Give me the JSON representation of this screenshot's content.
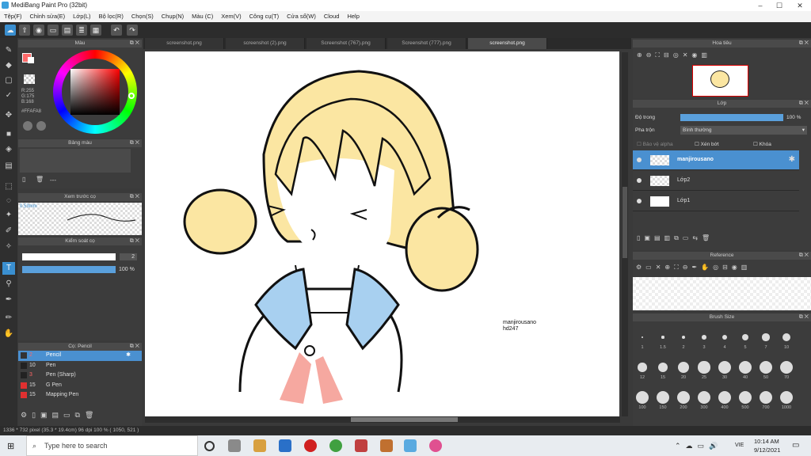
{
  "window": {
    "title": "MediBang Paint Pro (32bit)",
    "minimize": "–",
    "maximize": "☐",
    "close": "✕"
  },
  "menu": [
    "Tệp(F)",
    "Chỉnh sửa(E)",
    "Lớp(L)",
    "Bộ lọc(R)",
    "Chọn(S)",
    "Chụp(N)",
    "Màu (C)",
    "Xem(V)",
    "Công cụ(T)",
    "Cửa sổ(W)",
    "Cloud",
    "Help"
  ],
  "tabs": [
    "screenshot.png",
    "screenshot (2).png",
    "Screenshot (767).png",
    "Screenshot (777).png",
    "screenshot.png"
  ],
  "color_panel": {
    "title": "Màu",
    "r": "R:255",
    "g": "G:175",
    "b": "B:168",
    "hex": "#FFAFA8"
  },
  "palette_panel": {
    "title": "Bảng màu",
    "more": "---"
  },
  "preview_panel": {
    "title": "Xem trước cọ",
    "size": "0.53mm"
  },
  "control_panel": {
    "title": "Kiểm soát cọ",
    "size_value": "2",
    "opacity_value": "100 %"
  },
  "brush_panel": {
    "title": "Cọ: Pencil",
    "items": [
      {
        "size": "2",
        "name": "Pencil",
        "color": "#333333"
      },
      {
        "size": "10",
        "name": "Pen",
        "color": "#222222"
      },
      {
        "size": "3",
        "name": "Pen (Sharp)",
        "color": "#222222"
      },
      {
        "size": "15",
        "name": "G Pen",
        "color": "#e03030"
      },
      {
        "size": "15",
        "name": "Mapping Pen",
        "color": "#e03030"
      }
    ]
  },
  "canvas_text": {
    "line1": "manjirousano",
    "line2": "hd247"
  },
  "status": "1336 * 732 pixel  (35.3 * 19.4cm)  96 dpi  100 %  ( 1050, 521 )",
  "navigator": {
    "title": "Hoa tiêu"
  },
  "layer_panel": {
    "title": "Lớp",
    "opacity_label": "Độ trong",
    "opacity_value": "100 %",
    "blend_label": "Pha trộn",
    "blend_value": "Bình thường",
    "protect_alpha": "Bảo vệ alpha",
    "clipping": "Xén bớt",
    "lock": "Khóa",
    "layers": [
      "manjirousano",
      "Lớp2",
      "Lớp1"
    ]
  },
  "reference_panel": {
    "title": "Reference"
  },
  "size_panel": {
    "title": "Brush Size",
    "sizes": [
      "1",
      "1.5",
      "2",
      "3",
      "4",
      "5",
      "7",
      "10",
      "12",
      "15",
      "20",
      "25",
      "30",
      "40",
      "50",
      "70",
      "100",
      "150",
      "200",
      "300",
      "400",
      "500",
      "700",
      "1000"
    ]
  },
  "taskbar": {
    "search": "Type here to search",
    "time": "10:14 AM",
    "date": "9/12/2021",
    "lang": "VIE"
  }
}
